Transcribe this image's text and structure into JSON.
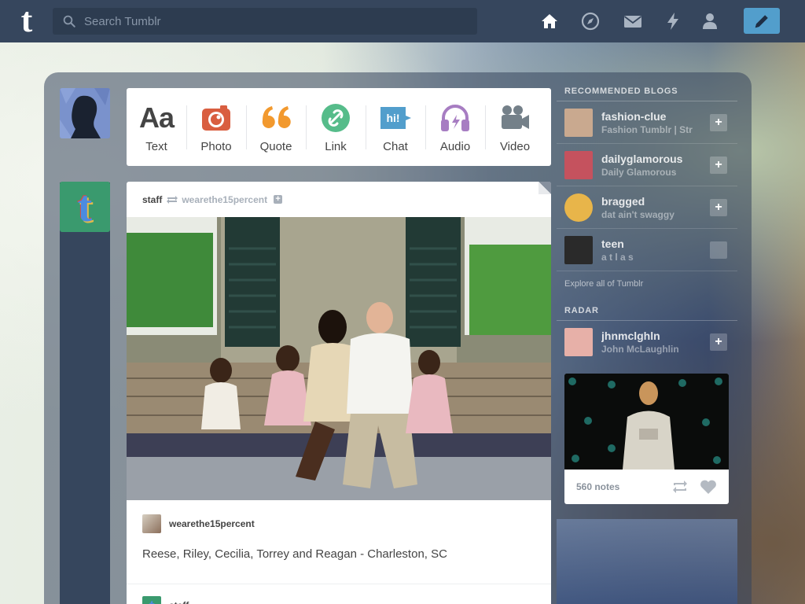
{
  "app": {
    "logo": "t"
  },
  "search": {
    "placeholder": "Search Tumblr"
  },
  "nav": {
    "icons": [
      "home-icon",
      "explore-icon",
      "inbox-icon",
      "activity-icon",
      "account-icon",
      "compose-icon"
    ]
  },
  "composer": {
    "types": [
      {
        "label": "Text",
        "icon": "text-icon",
        "glyph": "Aa",
        "color": "#444444"
      },
      {
        "label": "Photo",
        "icon": "camera-icon",
        "color": "#d95e40"
      },
      {
        "label": "Quote",
        "icon": "quote-icon",
        "glyph": "““",
        "color": "#f2992e"
      },
      {
        "label": "Link",
        "icon": "link-icon",
        "color": "#56bc8a"
      },
      {
        "label": "Chat",
        "icon": "chat-icon",
        "glyph": "hi!",
        "color": "#529ecc"
      },
      {
        "label": "Audio",
        "icon": "headphones-icon",
        "color": "#a77dc2"
      },
      {
        "label": "Video",
        "icon": "video-camera-icon",
        "color": "#748089"
      }
    ]
  },
  "post": {
    "author": "staff",
    "reblogged_from": "wearethe15percent",
    "source_name": "wearethe15percent",
    "caption": "Reese, Riley, Cecilia, Torrey and Reagan - Charleston, SC",
    "next_author": "staff"
  },
  "sidebar": {
    "recommended_title": "RECOMMENDED BLOGS",
    "blogs": [
      {
        "name": "fashion-clue",
        "subtitle": "Fashion Tumblr | Str",
        "color": "#c9a98f"
      },
      {
        "name": "dailyglamorous",
        "subtitle": "Daily Glamorous",
        "color": "#c5525e"
      },
      {
        "name": "bragged",
        "subtitle": "dat ain't swaggy",
        "color": "#e8b54a"
      },
      {
        "name": "teen",
        "subtitle": "a t l a s",
        "color": "#2a2a2a"
      }
    ],
    "explore_link": "Explore all of Tumblr",
    "radar_title": "RADAR",
    "radar": {
      "name": "jhnmclghln",
      "subtitle": "John McLaughlin",
      "color": "#e7b0a8",
      "notes": "560 notes"
    }
  },
  "colors": {
    "topbar": "#36465d",
    "compose": "#529ecc"
  }
}
